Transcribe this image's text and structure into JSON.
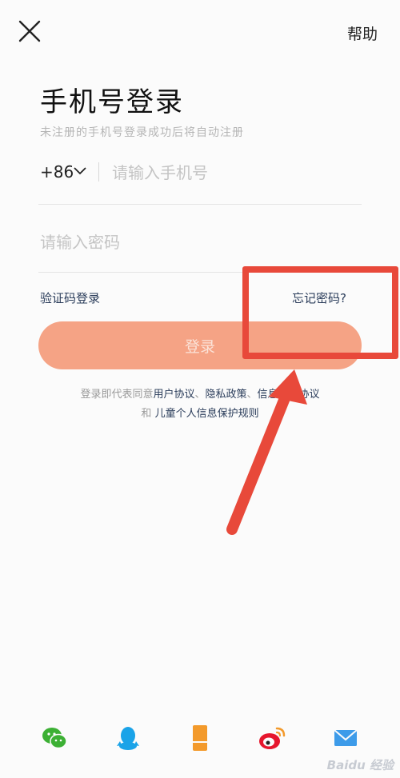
{
  "header": {
    "help_label": "帮助"
  },
  "login": {
    "title": "手机号登录",
    "subtitle": "未注册的手机号登录成功后将自动注册",
    "country_code": "+86",
    "phone_placeholder": "请输入手机号",
    "password_placeholder": "请输入密码",
    "code_login_label": "验证码登录",
    "forgot_password_label": "忘记密码?",
    "login_button_label": "登录"
  },
  "terms": {
    "prefix": "登录即代表同意",
    "user_agreement": "用户协议",
    "sep1": "、",
    "privacy_policy": "隐私政策",
    "sep2": "、",
    "third_party": "信息用户协议",
    "and": "和",
    "child_policy": "儿童个人信息保护规则"
  },
  "social": [
    {
      "icon": "wechat-icon",
      "color": "#3cb034"
    },
    {
      "icon": "qq-icon",
      "color": "#1aa3e8"
    },
    {
      "icon": "phone-icon",
      "color": "#f39a2b"
    },
    {
      "icon": "weibo-icon",
      "color": "#e6162d"
    },
    {
      "icon": "mail-icon",
      "color": "#3d9be9"
    }
  ],
  "watermark": "Baidu 经验",
  "colors": {
    "accent": "#f5a385",
    "annotation": "#e8493a",
    "link": "#2a3c5a"
  }
}
